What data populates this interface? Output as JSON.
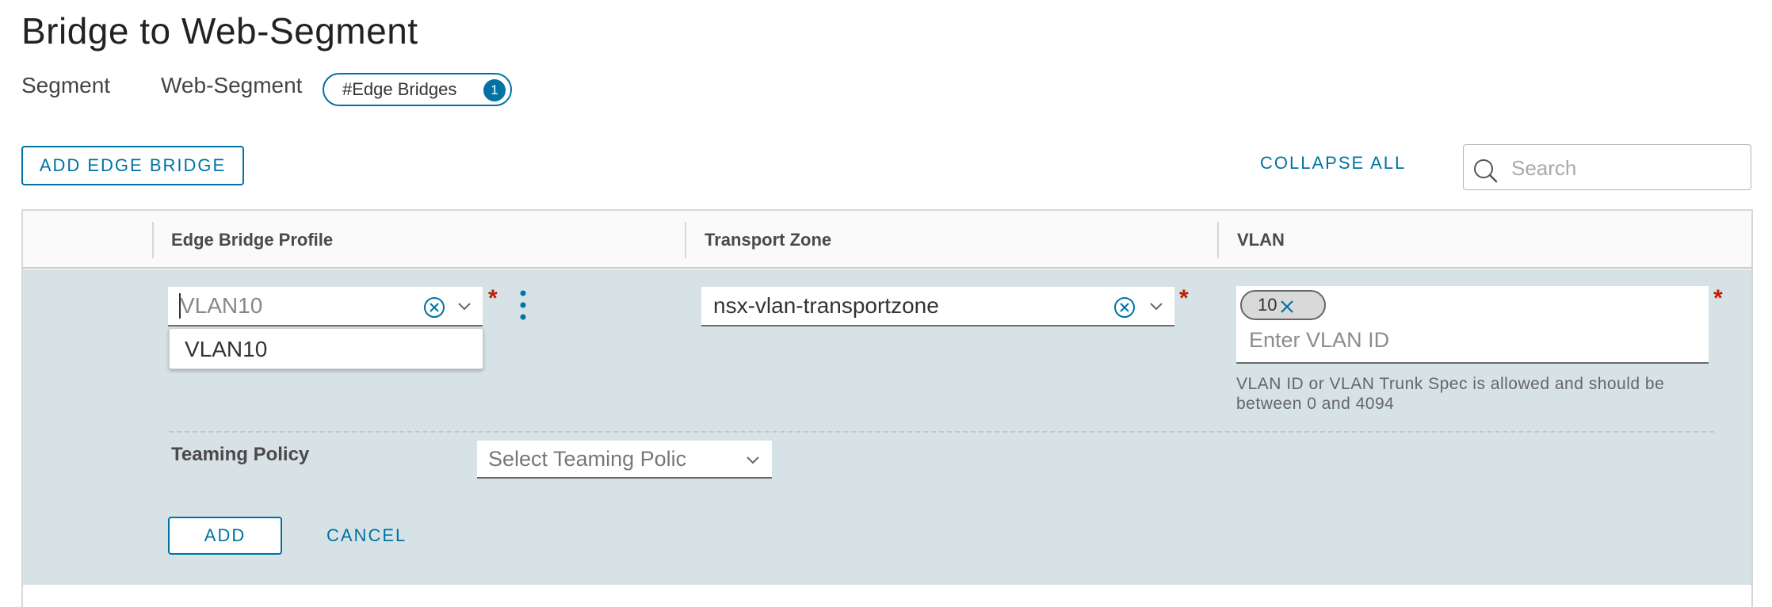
{
  "page": {
    "title": "Bridge to Web-Segment"
  },
  "breadcrumb": {
    "segment_label": "Segment",
    "segment_name": "Web-Segment",
    "pill_label": "#Edge Bridges",
    "pill_count": "1"
  },
  "toolbar": {
    "add_edge_bridge_label": "ADD EDGE BRIDGE",
    "collapse_all_label": "COLLAPSE ALL",
    "search_placeholder": "Search"
  },
  "table": {
    "columns": [
      "Edge Bridge Profile",
      "Transport Zone",
      "VLAN"
    ]
  },
  "row": {
    "edge_bridge_profile": {
      "value": "VLAN10",
      "required_mark": "*",
      "dropdown_options": [
        "VLAN10"
      ]
    },
    "transport_zone": {
      "value": "nsx-vlan-transportzone",
      "required_mark": "*"
    },
    "vlan": {
      "chips": [
        "10"
      ],
      "placeholder": "Enter VLAN ID",
      "required_mark": "*",
      "helper_text": "VLAN ID or VLAN Trunk Spec is allowed and should be between 0 and 4094"
    },
    "teaming_policy": {
      "label": "Teaming Policy",
      "placeholder": "Select Teaming Polic"
    },
    "actions": {
      "add_label": "ADD",
      "cancel_label": "CANCEL"
    }
  },
  "colors": {
    "accent": "#0072a3",
    "required": "#c21d00",
    "row_background": "#d6e2e6"
  },
  "icons": {
    "search": "search-icon",
    "clear": "clear-circle-icon",
    "chevron": "chevron-down-icon",
    "kebab": "vertical-ellipsis-icon",
    "chip_remove": "close-icon"
  }
}
